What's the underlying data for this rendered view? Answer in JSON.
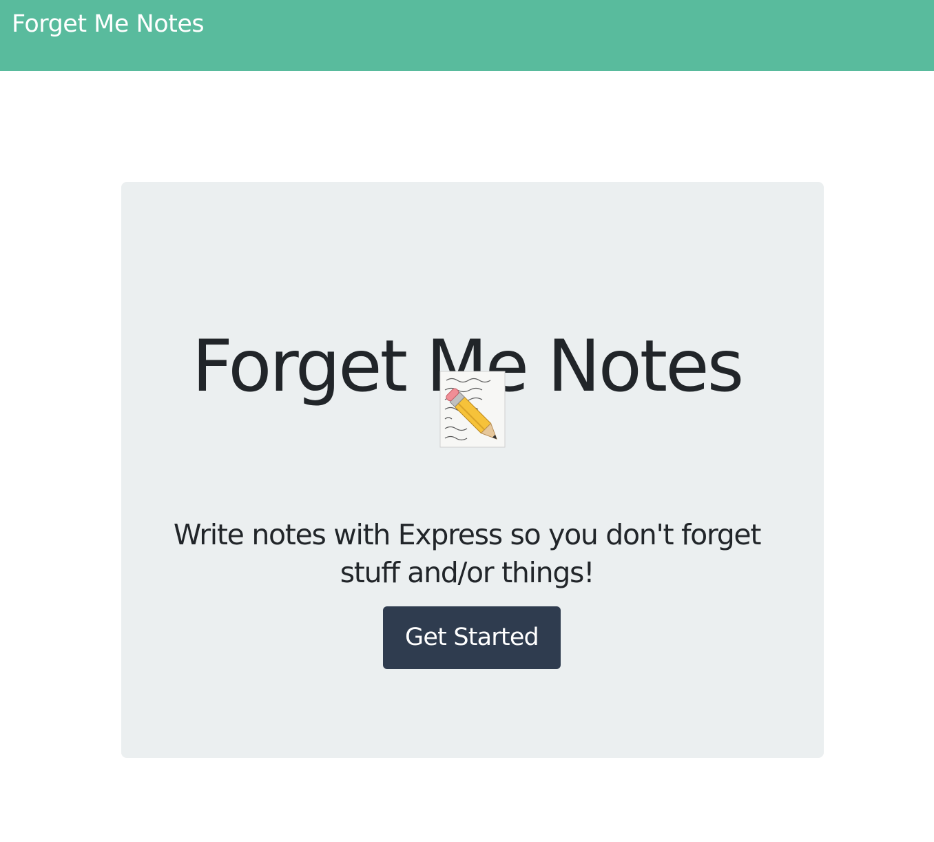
{
  "navbar": {
    "brand": "Forget Me Notes",
    "background_color": "#59bb9d"
  },
  "hero": {
    "title": "Forget Me Notes",
    "icon": "memo-pencil-icon",
    "line1": "Write notes with Express so you don't forget",
    "line2": "stuff and/or things!",
    "button_label": "Get Started",
    "button_color": "#2f3c4f",
    "panel_color": "#ebeff0"
  }
}
